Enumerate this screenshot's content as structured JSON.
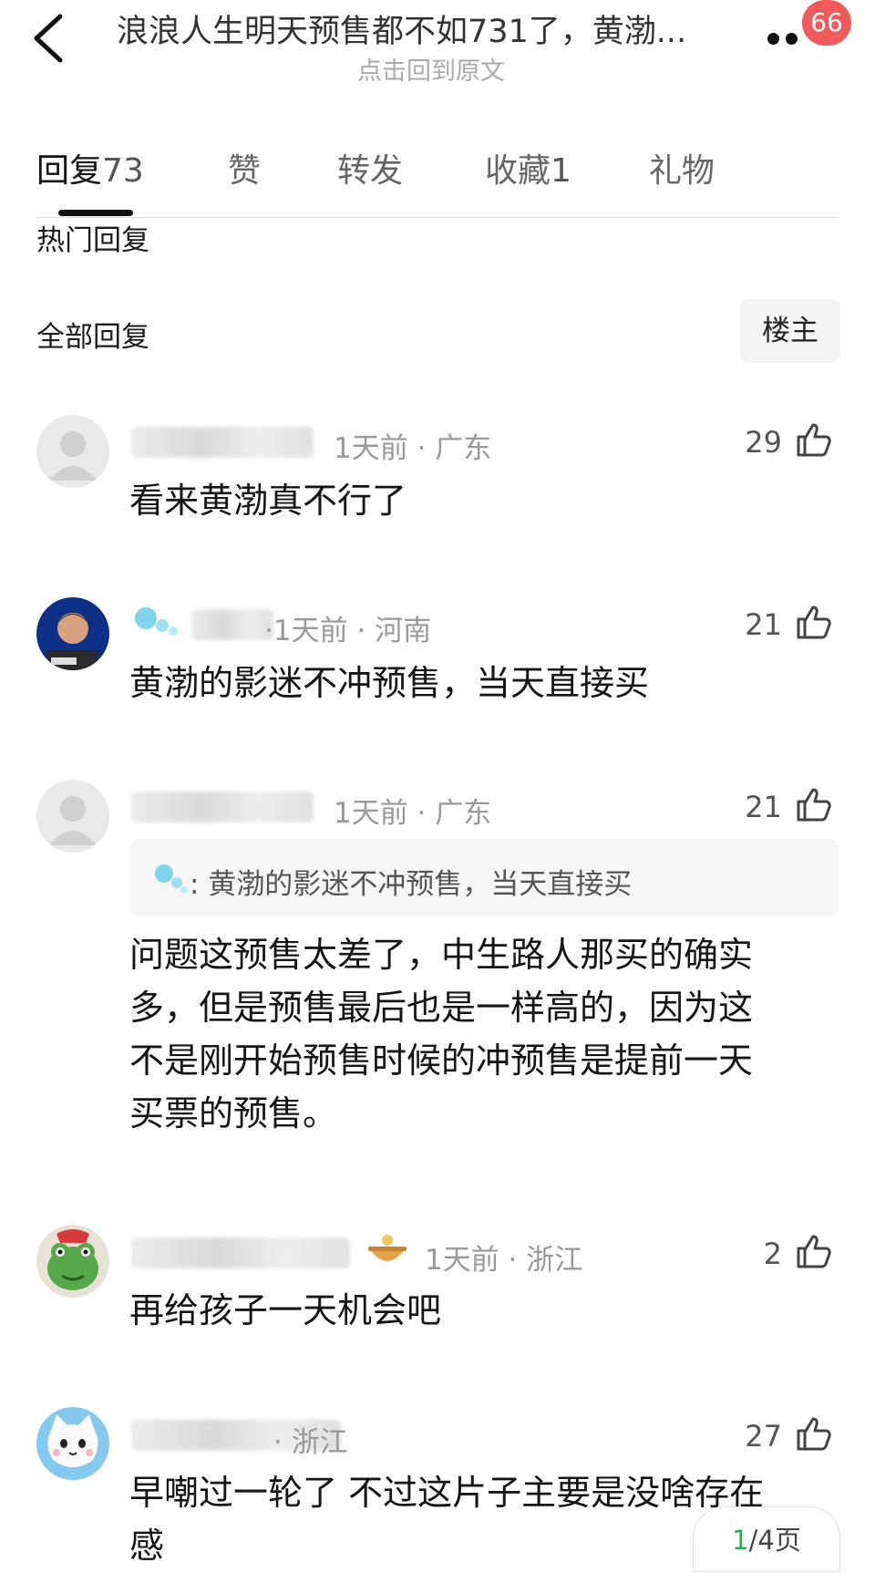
{
  "header": {
    "title": "浪浪人生明天预售都不如731了，黄渤...",
    "subtitle": "点击回到原文",
    "badge": "66"
  },
  "tabs": [
    {
      "label": "回复",
      "count": "73"
    },
    {
      "label": "赞",
      "count": ""
    },
    {
      "label": "转发",
      "count": ""
    },
    {
      "label": "收藏",
      "count": "1"
    },
    {
      "label": "礼物",
      "count": ""
    }
  ],
  "sections": {
    "hot": "热门回复",
    "all": "全部回复",
    "op_filter": "楼主"
  },
  "comments": [
    {
      "time": "1天前 · 广东",
      "likes": "29",
      "text": "看来黄渤真不行了",
      "avatar": "default-avatar"
    },
    {
      "time": "·1天前 · 河南",
      "likes": "21",
      "text": "黄渤的影迷不冲预售，当天直接买",
      "avatar": "man-photo-avatar"
    },
    {
      "time": "1天前 · 广东",
      "likes": "21",
      "quote": ": 黄渤的影迷不冲预售，当天直接买",
      "text_lines": [
        "问题这预售太差了，中生路人那买的确实",
        "多，但是预售最后也是一样高的，因为这",
        "不是刚开始预售时候的冲预售是提前一天",
        "买票的预售。"
      ],
      "avatar": "default-avatar"
    },
    {
      "time": "1天前 · 浙江",
      "likes": "2",
      "text": "再给孩子一天机会吧",
      "avatar": "frog-avatar"
    },
    {
      "time": "· 浙江",
      "likes": "27",
      "text_lines": [
        "早嘲过一轮了 不过这片子主要是没啥存在",
        "感"
      ],
      "avatar": "cat-avatar"
    }
  ],
  "pagination": {
    "current": "1",
    "rest": "/4页"
  },
  "colors": {
    "badge": "#f15a5a",
    "page_current": "#2eaa5a",
    "meta": "#999999"
  }
}
